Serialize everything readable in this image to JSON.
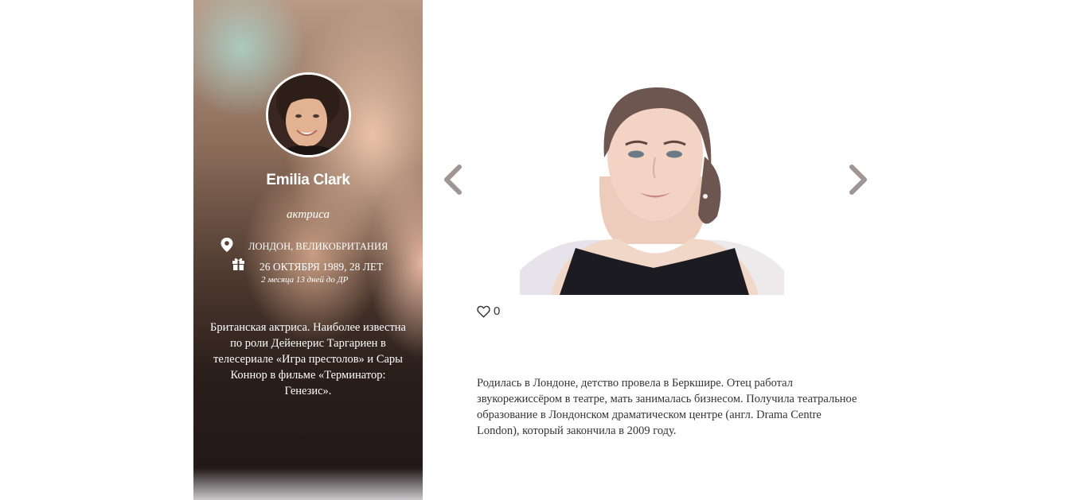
{
  "profile": {
    "name": "Emilia Clark",
    "role": "актриса",
    "location": "ЛОНДОН, ВЕЛИКОБРИТАНИЯ",
    "birth": "26 ОКТЯБРЯ 1989, 28 ЛЕТ",
    "birthday_countdown": "2 месяца 13 дней до ДР",
    "bio": "Британская актриса. Наиболее известна по роли Дейенерис Таргариен в телесериале «Игра престолов» и Сары Коннор в фильме «Терминатор: Генезис»."
  },
  "gallery": {
    "prev_icon": "chevron-left-icon",
    "next_icon": "chevron-right-icon",
    "arrow_color": "#9e9594"
  },
  "likes": {
    "icon": "heart-outline-icon",
    "count": "0"
  },
  "description": "Родилась в Лондоне, детство провела в Беркшире. Отец работал звукорежиссёром в театре, мать занималась бизнесом. Получила театральное образование в Лондонском драматическом центре (англ. Drama Centre London), который закончила в 2009 году."
}
